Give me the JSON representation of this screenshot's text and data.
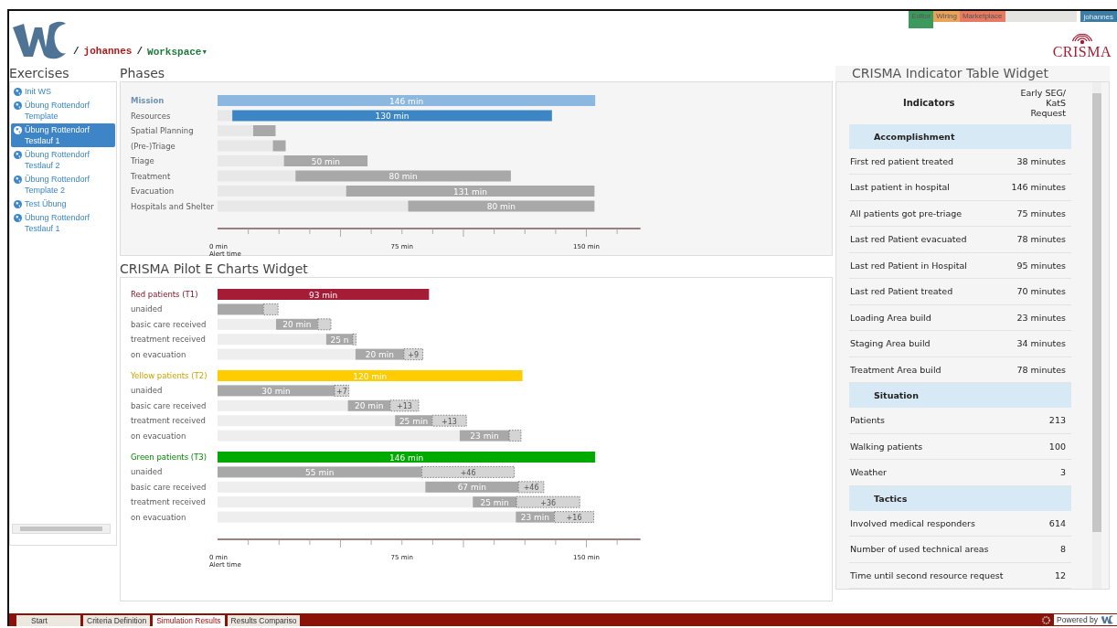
{
  "breadcrumb": [
    {
      "kind": "sep",
      "text": "/"
    },
    {
      "kind": "user",
      "text": "johannes"
    },
    {
      "kind": "sep",
      "text": "/"
    },
    {
      "kind": "workspace",
      "text": "Workspace▾"
    }
  ],
  "top_tabs": [
    {
      "label": "Editor",
      "selected": true,
      "color": "#3d9a5c"
    },
    {
      "label": "Wiring",
      "selected": false,
      "color": "#e9a35a"
    },
    {
      "label": "Marketplace",
      "selected": false,
      "color": "#e77a62"
    }
  ],
  "user_button": "johannes",
  "brand": "CRISMA",
  "exercises": {
    "title": "Exercises",
    "items": [
      {
        "label": "Init WS",
        "selected": false
      },
      {
        "label": "Übung Rottendorf Template",
        "selected": false
      },
      {
        "label": "Übung Rottendorf Testlauf 1",
        "selected": true
      },
      {
        "label": "Übung Rottendorf Testlauf 2",
        "selected": false
      },
      {
        "label": "Übung Rottendorf Template 2",
        "selected": false
      },
      {
        "label": "Test Übung",
        "selected": false
      },
      {
        "label": "Übung Rottendorf Testlauf 1",
        "selected": false
      }
    ]
  },
  "phases": {
    "title": "Phases",
    "chart_data": {
      "type": "bar",
      "orientation": "horizontal",
      "stacked": true,
      "categories": [
        "Mission",
        "Resources",
        "Spatial Planning",
        "(Pre-)Triage",
        "Triage",
        "Treatment",
        "Evacuation",
        "Hospitals and Shelter"
      ],
      "series": [
        {
          "color": "#e8e8e8",
          "values": [
            0,
            6,
            14.5,
            22.5,
            27,
            31.7,
            52.3,
            77.5
          ]
        },
        {
          "color": "#8cb8e0",
          "values": [
            153.6,
            null,
            null,
            null,
            null,
            null,
            null,
            null
          ]
        },
        {
          "color": "#3d86c6",
          "values": [
            null,
            130,
            null,
            null,
            null,
            null,
            null,
            null
          ]
        },
        {
          "color": "#a8a8a8",
          "values": [
            null,
            null,
            9.1,
            5.2,
            34,
            87.6,
            101,
            75.8
          ]
        }
      ],
      "xlim": [
        0,
        172
      ],
      "xticks": [
        {
          "value": 0,
          "label": "0 min"
        },
        {
          "value": 75,
          "label": "75 min"
        },
        {
          "value": 150,
          "label": "150 min"
        }
      ],
      "annotations": [
        "Alert time"
      ]
    },
    "bar_labels": {
      "0": [
        "146 min"
      ],
      "1": [
        "130 min"
      ],
      "4": [
        "50 min"
      ],
      "5": [
        "80 min"
      ],
      "6": [
        "131 min"
      ],
      "7": [
        "80 min"
      ]
    }
  },
  "charts_widget": {
    "title": "CRISMA Pilot E Charts Widget",
    "chart_data": {
      "type": "bar",
      "orientation": "horizontal",
      "stacked": true,
      "categories": [
        "Red patients (T1)",
        "unaided",
        "basic care received",
        "treatment received",
        "on evacuation",
        "Yellow patients (T2)",
        "unaided",
        "basic care received",
        "treatment received",
        "on evacuation",
        "Green patients (T3)",
        "unaided",
        "basic care received",
        "treatment received",
        "on evacuation"
      ],
      "series": [
        {
          "color": "#eeeeee",
          "values": [
            0,
            0,
            23.8,
            44.2,
            56.1,
            0,
            0,
            53,
            72.2,
            98.5,
            0,
            0,
            84.5,
            103.8,
            121.3
          ]
        },
        {
          "color": "#a51c36",
          "values": [
            86,
            null,
            null,
            null,
            null,
            null,
            null,
            null,
            null,
            null,
            null,
            null,
            null,
            null,
            null
          ]
        },
        {
          "color": "#ffcc00",
          "values": [
            null,
            null,
            null,
            null,
            null,
            124,
            null,
            null,
            null,
            null,
            null,
            null,
            null,
            null,
            null
          ]
        },
        {
          "color": "#00aa00",
          "values": [
            null,
            null,
            null,
            null,
            null,
            null,
            null,
            null,
            null,
            null,
            153.6,
            null,
            null,
            null,
            null
          ]
        },
        {
          "color": "#a8a8a8",
          "values": [
            null,
            18.7,
            17,
            10.8,
            19.7,
            null,
            47.6,
            17.2,
            15.1,
            20.1,
            null,
            83.1,
            37.9,
            17.8,
            15.7
          ]
        },
        {
          "color": "#d4d4d4",
          "values": [
            null,
            5.9,
            5.3,
            1.3,
            7.7,
            null,
            5.8,
            11.6,
            13.9,
            4.8,
            null,
            37.6,
            10.3,
            25.7,
            16
          ]
        }
      ],
      "xlim": [
        0,
        172
      ],
      "xticks": [
        {
          "value": 0,
          "label": "0 min"
        },
        {
          "value": 75,
          "label": "75 min"
        },
        {
          "value": 150,
          "label": "150 min"
        }
      ],
      "annotations": [
        "Alert time"
      ]
    },
    "bar_labels": {
      "0": [
        "93 min"
      ],
      "2": [
        "20 min"
      ],
      "3": [
        "25 n"
      ],
      "4": [
        "20 min",
        "+9"
      ],
      "5": [
        "120 min"
      ],
      "6": [
        "30 min",
        "+7"
      ],
      "7": [
        "20 min",
        "+13"
      ],
      "8": [
        "25 min",
        "+13"
      ],
      "9": [
        "23 min"
      ],
      "10": [
        "146 min"
      ],
      "11": [
        "55 min",
        "+46"
      ],
      "12": [
        "67 min",
        "+46"
      ],
      "13": [
        "25 min",
        "+36"
      ],
      "14": [
        "23 min",
        "+16"
      ]
    }
  },
  "indicator_widget": {
    "title": "CRISMA Indicator Table Widget",
    "columns": [
      "Indicators",
      "Early SEG/ KatS Request"
    ],
    "rows": [
      {
        "kind": "section",
        "label": "Accomplishment"
      },
      {
        "kind": "row",
        "label": "First red patient treated",
        "value": "38 minutes"
      },
      {
        "kind": "row",
        "label": "Last patient in hospital",
        "value": "146 minutes"
      },
      {
        "kind": "row",
        "label": "All patients got pre-triage",
        "value": "75 minutes"
      },
      {
        "kind": "row",
        "label": "Last red Patient evacuated",
        "value": "78 minutes"
      },
      {
        "kind": "row",
        "label": "Last red Patient in Hospital",
        "value": "95 minutes"
      },
      {
        "kind": "row",
        "label": "Last red Patient treated",
        "value": "70 minutes"
      },
      {
        "kind": "row",
        "label": "Loading Area build",
        "value": "23 minutes"
      },
      {
        "kind": "row",
        "label": "Staging Area build",
        "value": "34 minutes"
      },
      {
        "kind": "row",
        "label": "Treatment Area build",
        "value": "78 minutes"
      },
      {
        "kind": "section",
        "label": "Situation"
      },
      {
        "kind": "row",
        "label": "Patients",
        "value": "213"
      },
      {
        "kind": "row",
        "label": "Walking patients",
        "value": "100"
      },
      {
        "kind": "row",
        "label": "Weather",
        "value": "3"
      },
      {
        "kind": "section",
        "label": "Tactics"
      },
      {
        "kind": "row",
        "label": "Involved medical responders",
        "value": "614"
      },
      {
        "kind": "row",
        "label": "Number of used technical areas",
        "value": "8"
      },
      {
        "kind": "row",
        "label": "Time until second resource request",
        "value": "12"
      }
    ]
  },
  "bottom_tabs": [
    {
      "label": "Start",
      "selected": false
    },
    {
      "label": "Criteria Definition",
      "selected": false
    },
    {
      "label": "Simulation Results",
      "selected": true
    },
    {
      "label": "Results Compariso",
      "selected": false
    }
  ],
  "powered_by": "Powered by"
}
